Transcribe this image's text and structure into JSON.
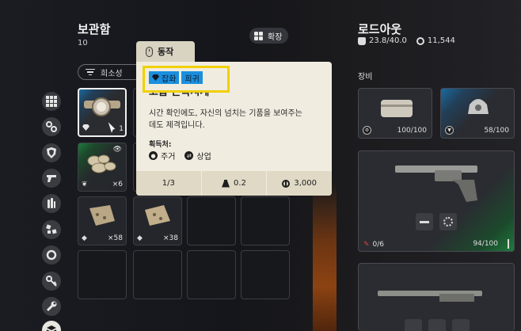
{
  "stash": {
    "title": "보관함",
    "count": "10",
    "expand_label": "확장",
    "filter_label": "희소성"
  },
  "categories": [
    {
      "icon": "grid-icon"
    },
    {
      "icon": "chain-icon"
    },
    {
      "icon": "shield-icon"
    },
    {
      "icon": "gun-icon"
    },
    {
      "icon": "ammo-icon"
    },
    {
      "icon": "crafting-icon"
    },
    {
      "icon": "ring-icon"
    },
    {
      "icon": "key-icon"
    },
    {
      "icon": "wrench-icon"
    },
    {
      "icon": "stack-icon"
    }
  ],
  "inventory": [
    {
      "name": "pocket-watch",
      "qty": "1",
      "rarity": "rare"
    },
    {
      "name": "mushrooms",
      "qty": "×6",
      "rarity": "uncommon"
    },
    {
      "name": "sack-1",
      "qty": "×58",
      "rarity": "common"
    },
    {
      "name": "sack-2",
      "qty": "×38",
      "rarity": "common"
    }
  ],
  "tooltip": {
    "tab_label": "동작",
    "tags": [
      "잡화",
      "희귀"
    ],
    "name": "고급 손목시계",
    "description": "시간 확인에도, 자신의 넘치는 기품을 보여주는 데도 제격입니다.",
    "acquire_label": "획득처:",
    "sources": [
      "주거",
      "상업"
    ],
    "stack": "1/3",
    "weight": "0.2",
    "price": "3,000"
  },
  "loadout": {
    "title": "로드아웃",
    "weight": "23.8/40.0",
    "money": "11,544",
    "equip_label": "장비",
    "gear": [
      {
        "name": "armor-vest",
        "durability": "100/100"
      },
      {
        "name": "helmet",
        "durability": "58/100"
      }
    ],
    "weapon": {
      "ammo": "0/6",
      "durability": "94/100"
    }
  },
  "colors": {
    "rare": "#1a8fe0",
    "uncommon": "#1e7a3c",
    "highlight": "#f0d000",
    "tooltip_bg": "#f1ece0"
  }
}
